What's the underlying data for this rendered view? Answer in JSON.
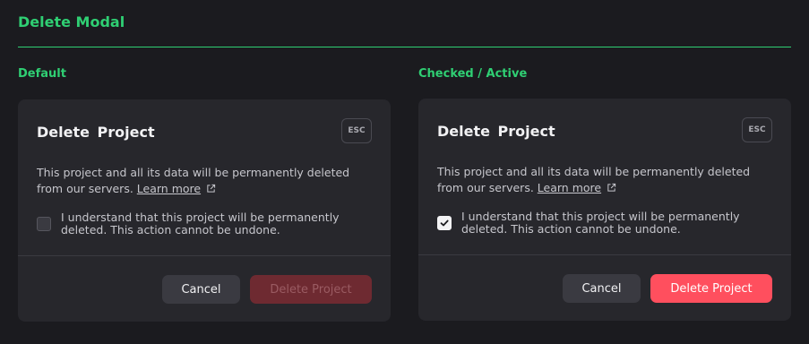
{
  "section_title": "Delete Modal",
  "colors": {
    "accent": "#2fcf73",
    "danger": "#ff4f5e",
    "danger_disabled": "#6e2a31",
    "modal_bg": "#27272c",
    "page_bg": "#1b1b1f"
  },
  "variants": [
    {
      "label": "Default",
      "modal": {
        "title": "Delete  Project",
        "esc_label": "ESC",
        "description": "This project and all its data will be permanently deleted from our servers.",
        "learn_more": "Learn more",
        "learn_more_icon": "external-link-icon",
        "checkbox_checked": false,
        "checkbox_label": "I understand that this project will be permanently deleted. This action cannot be undone.",
        "cancel_label": "Cancel",
        "delete_label": "Delete Project",
        "delete_enabled": false
      }
    },
    {
      "label": "Checked / Active",
      "modal": {
        "title": "Delete  Project",
        "esc_label": "ESC",
        "description": "This project and all its data will be permanently deleted from our servers.",
        "learn_more": "Learn more",
        "learn_more_icon": "external-link-icon",
        "checkbox_checked": true,
        "checkbox_label": "I understand that this project will be permanently deleted. This action cannot be undone.",
        "cancel_label": "Cancel",
        "delete_label": "Delete Project",
        "delete_enabled": true
      }
    }
  ]
}
